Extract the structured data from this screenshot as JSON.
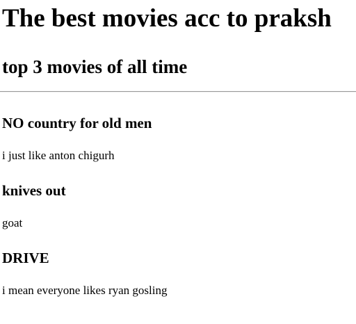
{
  "page": {
    "heading": "The best movies acc to praksh",
    "subheading": "top 3 movies of all time"
  },
  "movies": [
    {
      "title": "NO country for old men",
      "description": "i just like anton chigurh"
    },
    {
      "title": "knives out",
      "description": "goat"
    },
    {
      "title": "DRIVE",
      "description": "i mean everyone likes ryan gosling"
    }
  ]
}
